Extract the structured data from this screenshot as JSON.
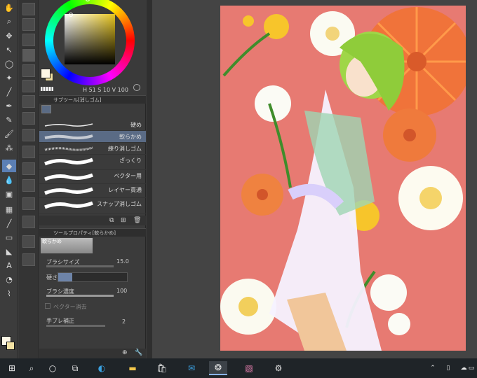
{
  "color": {
    "fg": "#fdf7e6",
    "bg": "#f3e2a4",
    "hue_accent": "#e6c41e",
    "hsv_h": "51",
    "hsv_s": "10",
    "hsv_v": "100",
    "hsv_label": "51  10  100"
  },
  "subtool_panel": {
    "title": "サブツール[消しゴム]",
    "items": [
      {
        "label": "硬め"
      },
      {
        "label": "軟らかめ"
      },
      {
        "label": "練り消しゴム"
      },
      {
        "label": "ざっくり"
      },
      {
        "label": "ベクター用"
      },
      {
        "label": "レイヤー貫通"
      },
      {
        "label": "スナップ消しゴム"
      }
    ],
    "selected_index": 1
  },
  "tool_property": {
    "title": "ツールプロパティ[軟らかめ]",
    "preset_name": "軟らかめ",
    "brush_size_label": "ブラシサイズ",
    "brush_size_value": "15.0",
    "hardness_label": "硬さ",
    "density_label": "ブラシ濃度",
    "density_value": "100",
    "vector_erase_label": "ベクター消去",
    "stabilization_label": "手ブレ補正",
    "stabilization_value": "2"
  },
  "accent": "#5b7fb5",
  "canvas": {
    "background": "#e77a72"
  },
  "taskbar": {
    "icons": [
      "windows-icon",
      "search-icon",
      "cortana-icon",
      "task-view-icon",
      "edge-icon",
      "explorer-icon",
      "store-icon",
      "mail-icon",
      "clip-studio-icon",
      "paint-app-icon",
      "settings-icon"
    ]
  }
}
